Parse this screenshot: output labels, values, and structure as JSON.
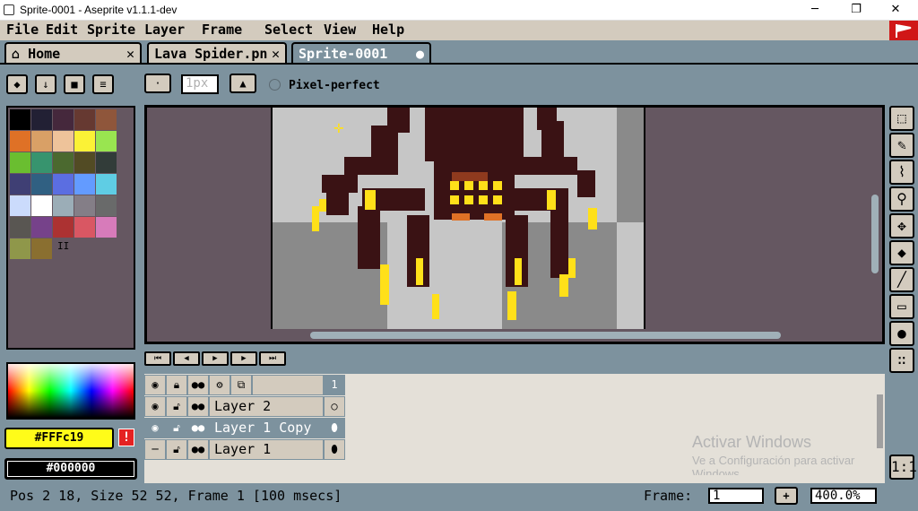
{
  "window": {
    "title": "Sprite-0001 - Aseprite v1.1.1-dev",
    "min": "─",
    "max": "❐",
    "close": "✕"
  },
  "menu": [
    "File",
    "Edit",
    "Sprite",
    "Layer",
    "Frame",
    "Select",
    "View",
    "Help"
  ],
  "tabs": [
    {
      "label": "Home",
      "close": "✕"
    },
    {
      "label": "Lava Spider.pn",
      "close": "✕"
    },
    {
      "label": "Sprite-0001",
      "close": "●"
    }
  ],
  "context_bar": {
    "brush_size": "1px",
    "pixel_perfect_label": "Pixel-perfect"
  },
  "palette_colors": [
    "#000000",
    "#222034",
    "#45283c",
    "#663931",
    "#8f563b",
    "#df7126",
    "#d9a066",
    "#eec39a",
    "#fbf236",
    "#99e550",
    "#6abe30",
    "#37946e",
    "#4b692f",
    "#524b24",
    "#323c39",
    "#3f3f74",
    "#306082",
    "#5b6ee1",
    "#639bff",
    "#5fcde4",
    "#cbdbfc",
    "#ffffff",
    "#9badb7",
    "#847e87",
    "#696a6a",
    "#595652",
    "#76428a",
    "#ac3232",
    "#d95763",
    "#d77bba",
    "#8f974a",
    "#8a6f30"
  ],
  "palette_marker": "II",
  "colors": {
    "fg_label": "#FFFc19",
    "bg_label": "#000000",
    "warn_icon": "!"
  },
  "tools": [
    "marquee",
    "pencil",
    "eyedropper",
    "zoom",
    "move",
    "bucket",
    "line",
    "rectangle",
    "blob",
    "spray"
  ],
  "animation_buttons": [
    "⏮",
    "◀",
    "▶",
    "▶",
    "⏭"
  ],
  "timeline": {
    "frame_header": "1",
    "layers": [
      {
        "name": "Layer 2",
        "visible": true,
        "highlighted": false
      },
      {
        "name": "Layer 1 Copy",
        "visible": true,
        "highlighted": true
      },
      {
        "name": "Layer 1",
        "visible": false,
        "highlighted": false
      }
    ],
    "zoom_btn": "1:1"
  },
  "watermark": {
    "line1": "Activar Windows",
    "line2": "Ve a Configuración para activar",
    "line3": "Windows."
  },
  "status": {
    "text": "Pos 2 18, Size 52 52, Frame 1 [100 msecs]",
    "frame_label": "Frame:",
    "frame_value": "1",
    "plus": "+",
    "zoom": "400.0%"
  },
  "theme": {
    "accent": "#7d929e",
    "panel": "#d3cbbe",
    "fg": "#fffc19"
  }
}
